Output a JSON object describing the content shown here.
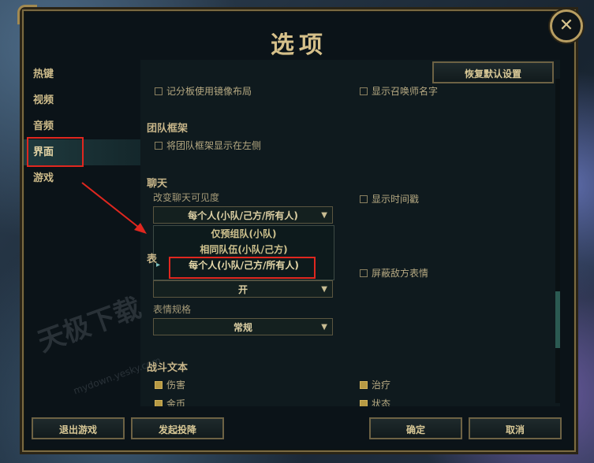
{
  "window": {
    "title": "选项",
    "close_glyph": "✕"
  },
  "nav": {
    "items": [
      {
        "label": "热键"
      },
      {
        "label": "视频"
      },
      {
        "label": "音频"
      },
      {
        "label": "界面"
      },
      {
        "label": "游戏"
      }
    ],
    "active_index": 3
  },
  "content": {
    "restore_defaults": "恢复默认设置",
    "top_row": {
      "left_check": "记分板使用镜像布局",
      "right_check": "显示召唤师名字"
    },
    "team_frame": {
      "heading": "团队框架",
      "option": "将团队框架显示在左侧"
    },
    "chat": {
      "heading": "聊天",
      "visibility_label": "改变聊天可见度",
      "visibility_value": "每个人(小队/己方/所有人)",
      "timestamp_check": "显示时间戳",
      "dropdown_options": [
        "仅预组队(小队)",
        "相同队伍(小队/己方)",
        "每个人(小队/己方/所有人)"
      ],
      "selected_option_index": 2
    },
    "emotes": {
      "heading_fragment": "表",
      "toggle_value": "开",
      "mute_enemy_check": "屏蔽敌方表情",
      "scale_label": "表情规格",
      "scale_value": "常规"
    },
    "combat_text": {
      "heading": "战斗文本",
      "left_check": "伤害",
      "left_check_cut": "金币",
      "right_check": "治疗",
      "right_check_cut": "状态"
    }
  },
  "footer": {
    "quit_game": "退出游戏",
    "surrender": "发起投降",
    "confirm": "确定",
    "cancel": "取消"
  },
  "annotations": {
    "highlight_color": "#e0271f"
  },
  "watermark": {
    "text": "天极下载",
    "url": "mydown.yesky.com"
  },
  "icons": {
    "dropdown_arrow": "▼",
    "option_pointer": "▸"
  }
}
